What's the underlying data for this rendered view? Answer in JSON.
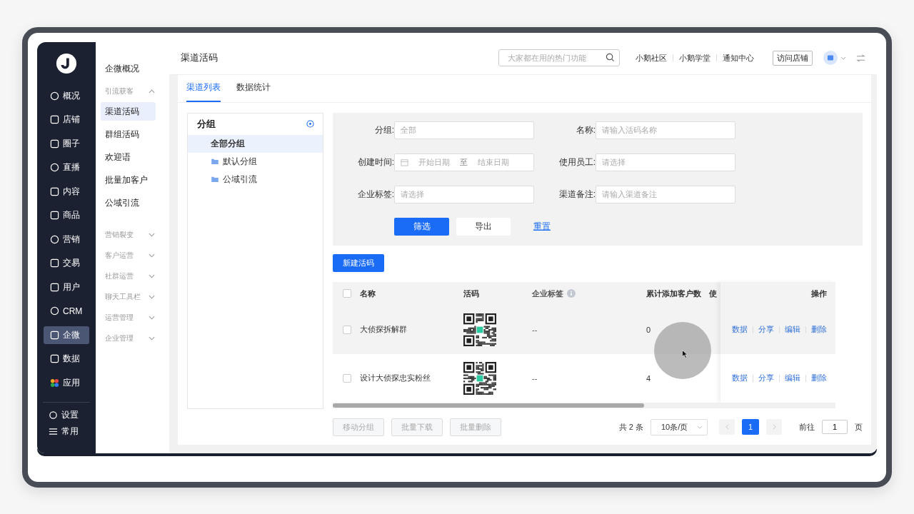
{
  "rail": {
    "items": [
      {
        "label": "概况",
        "selected": false
      },
      {
        "label": "店铺",
        "selected": false
      },
      {
        "label": "圈子",
        "selected": false
      },
      {
        "label": "直播",
        "selected": false
      },
      {
        "label": "内容",
        "selected": false
      },
      {
        "label": "商品",
        "selected": false
      },
      {
        "label": "营销",
        "selected": false
      },
      {
        "label": "交易",
        "selected": false
      },
      {
        "label": "用户",
        "selected": false
      },
      {
        "label": "CRM",
        "selected": false
      },
      {
        "label": "企微",
        "selected": true
      },
      {
        "label": "数据",
        "selected": false
      },
      {
        "label": "应用",
        "selected": false
      }
    ],
    "bottom_items": [
      {
        "label": "设置"
      },
      {
        "label": "常用"
      }
    ]
  },
  "submenu": [
    {
      "kind": "link",
      "label": "企微概况",
      "selected": false
    },
    {
      "kind": "section",
      "label": "引流获客",
      "expanded": true,
      "children": [
        {
          "label": "渠道活码",
          "selected": true
        },
        {
          "label": "群组活码",
          "selected": false
        },
        {
          "label": "欢迎语",
          "selected": false
        },
        {
          "label": "批量加客户",
          "selected": false
        },
        {
          "label": "公域引流",
          "selected": false
        }
      ]
    },
    {
      "kind": "section",
      "label": "营销裂变",
      "expanded": false
    },
    {
      "kind": "section",
      "label": "客户运营",
      "expanded": false
    },
    {
      "kind": "section",
      "label": "社群运营",
      "expanded": false
    },
    {
      "kind": "section",
      "label": "聊天工具栏",
      "expanded": false
    },
    {
      "kind": "section",
      "label": "运营管理",
      "expanded": false
    },
    {
      "kind": "section",
      "label": "企业管理",
      "expanded": false
    }
  ],
  "header": {
    "title": "渠道活码",
    "search": {
      "placeholder": "大家都在用的热门功能"
    },
    "links": [
      "小鹅社区",
      "小鹅学堂",
      "通知中心"
    ],
    "visit_button": "访问店铺"
  },
  "tabs": [
    {
      "label": "渠道列表",
      "selected": true
    },
    {
      "label": "数据统计",
      "selected": false
    }
  ],
  "groups": {
    "title": "分组",
    "items": [
      {
        "label": "全部分组",
        "selected": true,
        "children": [
          {
            "label": "默认分组",
            "selected": false
          },
          {
            "label": "公域引流",
            "selected": false
          }
        ]
      }
    ]
  },
  "filters": [
    {
      "kind": "input",
      "label": "分组:",
      "placeholder": "全部"
    },
    {
      "kind": "input",
      "label": "名称:",
      "placeholder": "请输入活码名称"
    },
    {
      "kind": "date_range",
      "label": "创建时间:",
      "start_placeholder": "开始日期",
      "separator": "至",
      "end_placeholder": "结束日期"
    },
    {
      "kind": "input",
      "label": "使用员工:",
      "placeholder": "请选择"
    },
    {
      "kind": "input",
      "label": "企业标签:",
      "placeholder": "请选择"
    },
    {
      "kind": "input",
      "label": "渠道备注:",
      "placeholder": "请输入渠道备注"
    }
  ],
  "filter_buttons": [
    {
      "kind": "primary",
      "label": "筛选"
    },
    {
      "kind": "default",
      "label": "导出"
    },
    {
      "kind": "link",
      "label": "重置"
    }
  ],
  "new_button": "新建活码",
  "table": {
    "select_all_checked": false,
    "columns": [
      "名称",
      "活码",
      "企业标签",
      "累计添加客户数",
      "使",
      "操作"
    ],
    "rows": [
      {
        "checked": false,
        "hovered": true,
        "name": "大侦探拆解群",
        "tags": "--",
        "count": "0",
        "actions": [
          "数据",
          "分享",
          "编辑",
          "删除"
        ]
      },
      {
        "checked": false,
        "hovered": false,
        "name": "设计大侦探忠实粉丝",
        "tags": "--",
        "count": "4",
        "actions": [
          "数据",
          "分享",
          "编辑",
          "删除"
        ]
      }
    ]
  },
  "batch_buttons": [
    {
      "label": "移动分组",
      "disabled": true
    },
    {
      "label": "批量下载",
      "disabled": true
    },
    {
      "label": "批量删除",
      "disabled": true
    }
  ],
  "pagination": {
    "total": "共 2 条",
    "page_size": "10条/页",
    "pages": [
      {
        "label": "1",
        "selected": true
      }
    ],
    "goto_label": "前往",
    "goto_value": "1",
    "goto_suffix": "页"
  }
}
